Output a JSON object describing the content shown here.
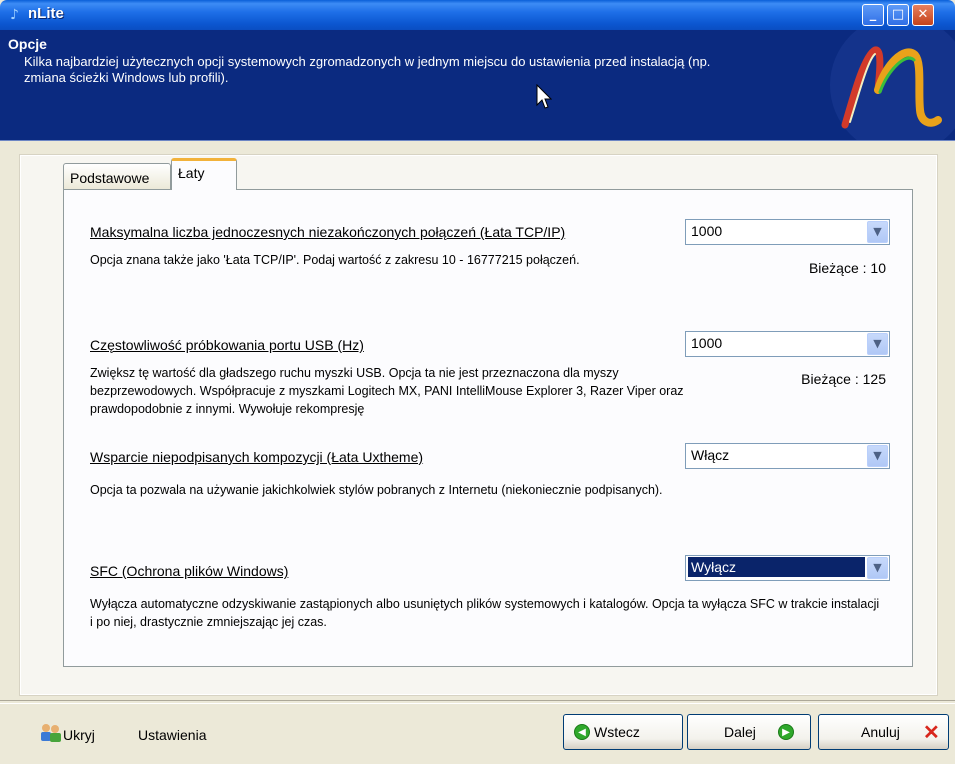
{
  "window": {
    "title": "nLite",
    "controls": {
      "minimize": "_",
      "maximize": "□",
      "close": "✕"
    }
  },
  "header": {
    "title": "Opcje",
    "description": "Kilka najbardziej użytecznych opcji systemowych zgromadzonych w jednym miejscu do ustawienia przed instalacją (np. zmiana ścieżki Windows lub profili)."
  },
  "tabs": [
    {
      "label": "Podstawowe",
      "active": false
    },
    {
      "label": "Łaty",
      "active": true
    }
  ],
  "options": [
    {
      "title": "Maksymalna liczba jednoczesnych niezakończonych połączeń (Łata TCP/IP)",
      "description": "Opcja znana także jako 'Łata TCP/IP'. Podaj wartość z zakresu 10 - 16777215 połączeń.",
      "current": "Bieżące : 10",
      "value": "1000"
    },
    {
      "title": "Częstowliwość próbkowania portu USB (Hz)",
      "description": "Zwiększ tę wartość dla gładszego ruchu myszki USB. Opcja ta nie jest przeznaczona dla myszy bezprzewodowych. Współpracuje z myszkami Logitech MX, PANI IntelliMouse Explorer 3, Razer Viper oraz prawdopodobnie z innymi. Wywołuje rekompresję",
      "current": "Bieżące : 125",
      "value": "1000"
    },
    {
      "title": "Wsparcie niepodpisanych kompozycji (Łata Uxtheme)",
      "description": "Opcja ta pozwala na używanie jakichkolwiek stylów pobranych z Internetu (niekoniecznie podpisanych).",
      "value": "Włącz"
    },
    {
      "title": "SFC (Ochrona plików Windows)",
      "description": "Wyłącza automatyczne odzyskiwanie zastąpionych albo usuniętych plików systemowych i katalogów. Opcja ta wyłącza SFC w trakcie instalacji i po niej, drastycznie zmniejszając jej czas.",
      "value": "Wyłącz"
    }
  ],
  "footer": {
    "hide_label": "Ukryj",
    "settings_label": "Ustawienia",
    "back_label": "Wstecz",
    "next_label": "Dalej",
    "cancel_label": "Anuluj"
  },
  "colors": {
    "header_bg": "#0b2a80",
    "selection": "#0a246a",
    "tab_accent": "#f2b23a"
  }
}
